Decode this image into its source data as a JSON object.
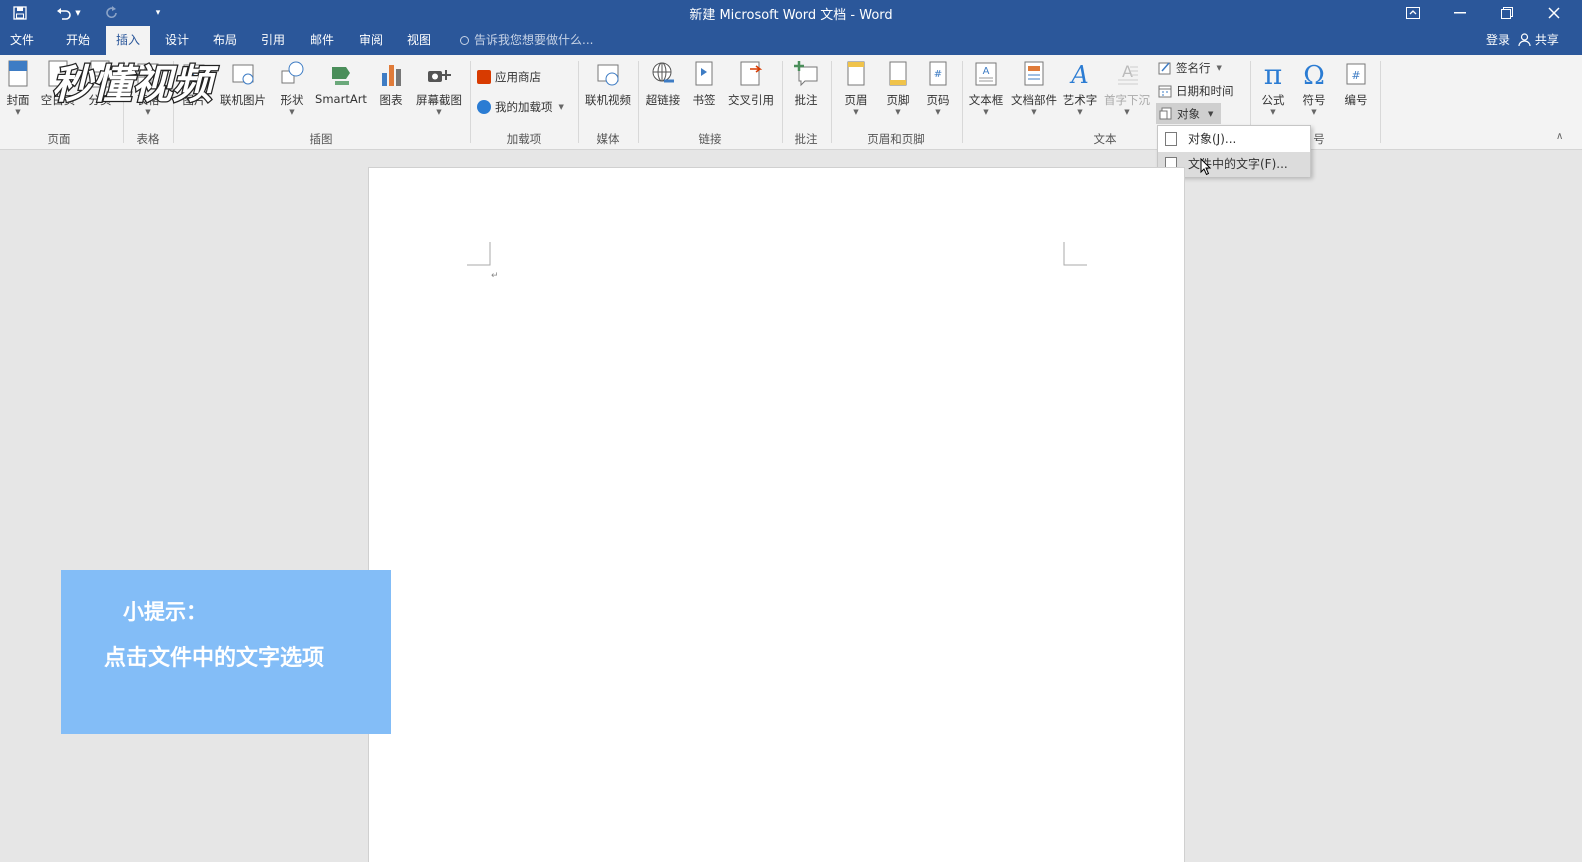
{
  "titlebar": {
    "title": "新建 Microsoft Word 文档 - Word"
  },
  "tabs": [
    "文件",
    "开始",
    "插入",
    "设计",
    "布局",
    "引用",
    "邮件",
    "审阅",
    "视图"
  ],
  "active_tab": "插入",
  "tellme_placeholder": "告诉我您想要做什么...",
  "account": {
    "login": "登录",
    "share": "共享"
  },
  "ribbon": {
    "buttons": {
      "cover": "封面",
      "blank_page": "空白页",
      "page_break": "分页",
      "table": "表格",
      "pictures": "图片",
      "online_pictures": "联机图片",
      "shapes": "形状",
      "smartart": "SmartArt",
      "chart": "图表",
      "screenshot": "屏幕截图",
      "store": "应用商店",
      "my_addins": "我的加载项",
      "online_video": "联机视频",
      "hyperlink": "超链接",
      "bookmark": "书签",
      "cross_ref": "交叉引用",
      "comment": "批注",
      "header": "页眉",
      "footer": "页脚",
      "page_number": "页码",
      "textbox": "文本框",
      "quick_parts": "文档部件",
      "wordart": "艺术字",
      "dropcap": "首字下沉",
      "signature_line": "签名行",
      "date_time": "日期和时间",
      "object": "对象",
      "equation": "公式",
      "symbol": "符号",
      "numbering": "编号"
    },
    "groups": {
      "pages": "页面",
      "tables": "表格",
      "illustrations": "插图",
      "addins": "加载项",
      "media": "媒体",
      "links": "链接",
      "comments": "批注",
      "header_footer": "页眉和页脚",
      "text": "文本",
      "symbols": "号"
    }
  },
  "object_menu": {
    "items": [
      "对象(J)...",
      "文件中的文字(F)..."
    ],
    "hovered_index": 1
  },
  "tip": {
    "title": "小提示：",
    "body": "点击文件中的文字选项"
  },
  "watermark": {
    "text": "秒懂视频"
  },
  "colors": {
    "brand": "#2b579a",
    "ribbon_bg": "#f3f3f3",
    "tip_bg": "#83bdf7",
    "doc_bg": "#e6e6e6"
  }
}
